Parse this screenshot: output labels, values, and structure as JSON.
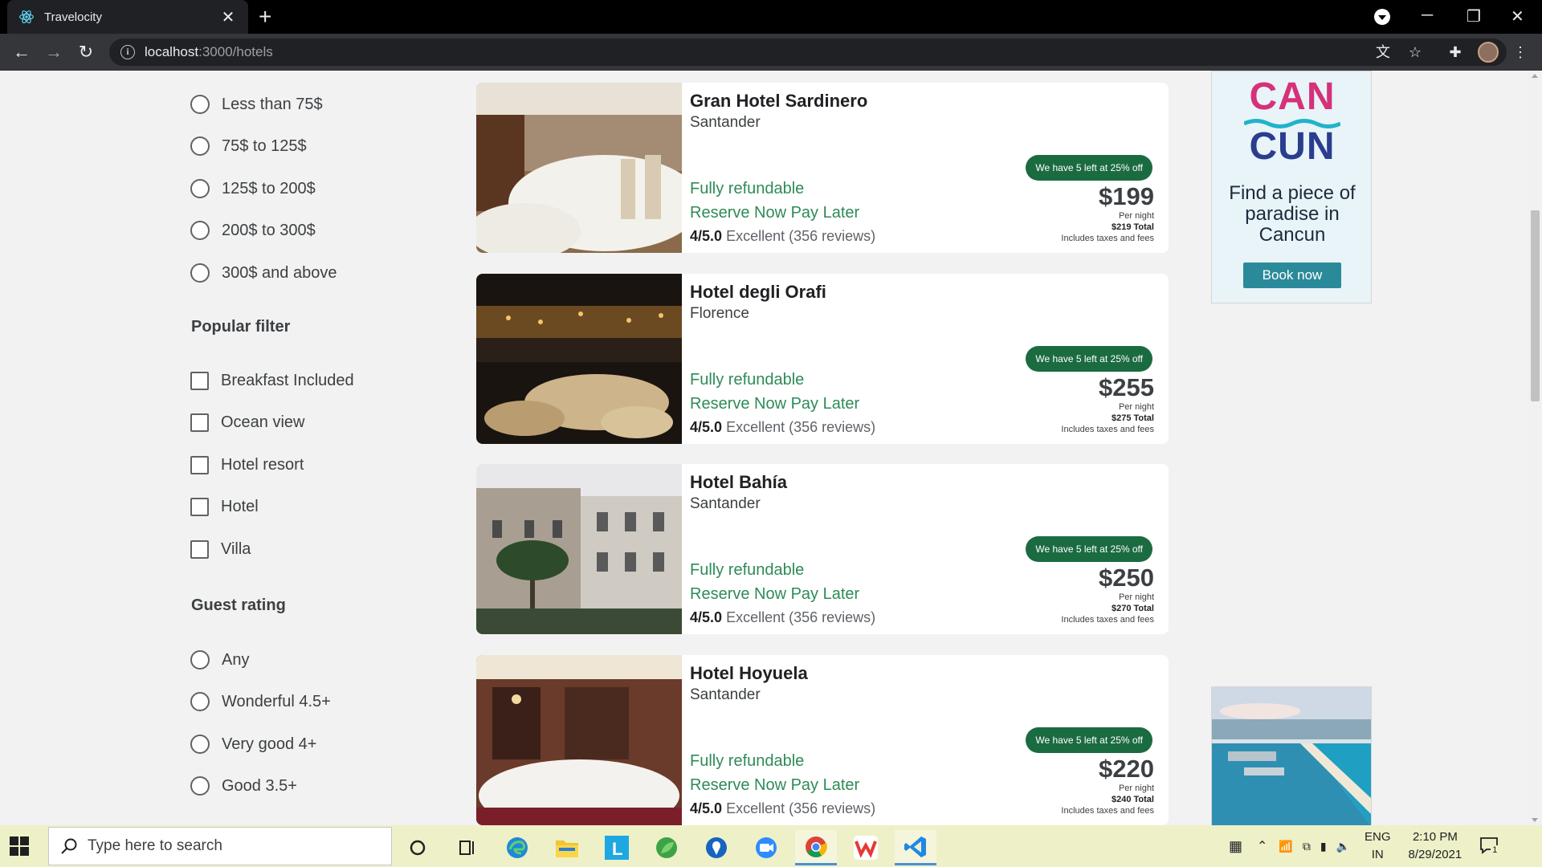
{
  "browser": {
    "tab_title": "Travelocity",
    "url_host": "localhost",
    "url_path": ":3000/hotels"
  },
  "filters": {
    "price_options": [
      "Less than 75$",
      "75$ to 125$",
      "125$ to 200$",
      "200$ to 300$",
      "300$ and above"
    ],
    "popular_title": "Popular filter",
    "popular_options": [
      "Breakfast Included",
      "Ocean view",
      "Hotel resort",
      "Hotel",
      "Villa"
    ],
    "guest_title": "Guest rating",
    "guest_options": [
      "Any",
      "Wonderful 4.5+",
      "Very good 4+",
      "Good 3.5+"
    ]
  },
  "hotels": [
    {
      "name": "Gran Hotel Sardinero",
      "city": "Santander",
      "refund": "Fully refundable",
      "reserve": "Reserve Now Pay Later",
      "score": "4/5.0",
      "review": "Excellent (356 reviews)",
      "badge": "We have 5 left at 25% off",
      "price": "$199",
      "per_night": "Per night",
      "total": "$219 Total",
      "taxes": "Includes taxes and fees"
    },
    {
      "name": "Hotel degli Orafi",
      "city": "Florence",
      "refund": "Fully refundable",
      "reserve": "Reserve Now Pay Later",
      "score": "4/5.0",
      "review": "Excellent (356 reviews)",
      "badge": "We have 5 left at 25% off",
      "price": "$255",
      "per_night": "Per night",
      "total": "$275 Total",
      "taxes": "Includes taxes and fees"
    },
    {
      "name": "Hotel Bahía",
      "city": "Santander",
      "refund": "Fully refundable",
      "reserve": "Reserve Now Pay Later",
      "score": "4/5.0",
      "review": "Excellent (356 reviews)",
      "badge": "We have 5 left at 25% off",
      "price": "$250",
      "per_night": "Per night",
      "total": "$270 Total",
      "taxes": "Includes taxes and fees"
    },
    {
      "name": "Hotel Hoyuela",
      "city": "Santander",
      "refund": "Fully refundable",
      "reserve": "Reserve Now Pay Later",
      "score": "4/5.0",
      "review": "Excellent (356 reviews)",
      "badge": "We have 5 left at 25% off",
      "price": "$220",
      "per_night": "Per night",
      "total": "$240 Total",
      "taxes": "Includes taxes and fees"
    }
  ],
  "ad": {
    "line1": "CAN",
    "line2": "CUN",
    "tagline": "Find a piece of paradise in Cancun",
    "button": "Book now"
  },
  "taskbar": {
    "search_placeholder": "Type here to search",
    "lang_top": "ENG",
    "lang_bottom": "IN",
    "time": "2:10 PM",
    "date": "8/29/2021",
    "notification_count": "1"
  },
  "colors": {
    "accent_green": "#2e8b57",
    "badge_green": "#1b6b41",
    "ad_button": "#2b8a99"
  }
}
